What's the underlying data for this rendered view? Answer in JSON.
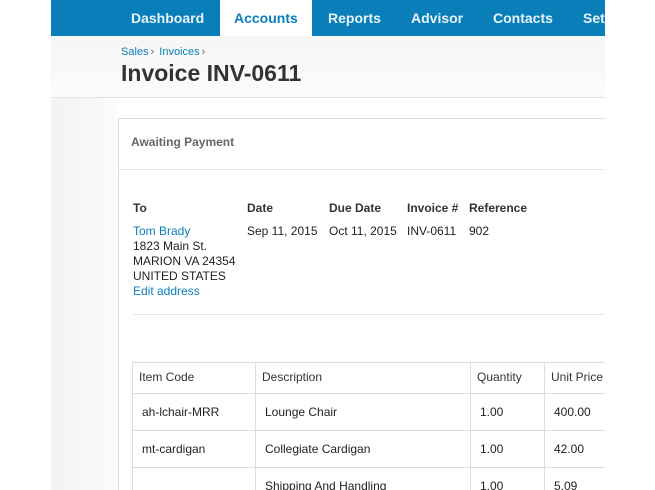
{
  "nav": {
    "items": [
      {
        "label": "Dashboard"
      },
      {
        "label": "Accounts",
        "active": true
      },
      {
        "label": "Reports"
      },
      {
        "label": "Advisor"
      },
      {
        "label": "Contacts"
      },
      {
        "label": "Set"
      }
    ],
    "accent_color": "#0a7eb9"
  },
  "breadcrumb": [
    "Sales",
    "Invoices"
  ],
  "page_title": "Invoice INV-0611",
  "invoice": {
    "status": "Awaiting Payment",
    "to": {
      "label": "To",
      "name": "Tom Brady",
      "address": [
        "1823 Main St.",
        "MARION VA 24354",
        "UNITED STATES"
      ],
      "edit_link": "Edit address"
    },
    "date": {
      "label": "Date",
      "value": "Sep 11, 2015"
    },
    "due_date": {
      "label": "Due Date",
      "value": "Oct 11, 2015"
    },
    "number": {
      "label": "Invoice #",
      "value": "INV-0611"
    },
    "reference": {
      "label": "Reference",
      "value": "902"
    }
  },
  "table": {
    "columns": [
      "Item Code",
      "Description",
      "Quantity",
      "Unit Price"
    ],
    "rows": [
      [
        "ah-lchair-MRR",
        "Lounge Chair",
        "1.00",
        "400.00"
      ],
      [
        "mt-cardigan",
        "Collegiate Cardigan",
        "1.00",
        "42.00"
      ],
      [
        "",
        "Shipping And Handling",
        "1.00",
        "5.09"
      ]
    ]
  }
}
